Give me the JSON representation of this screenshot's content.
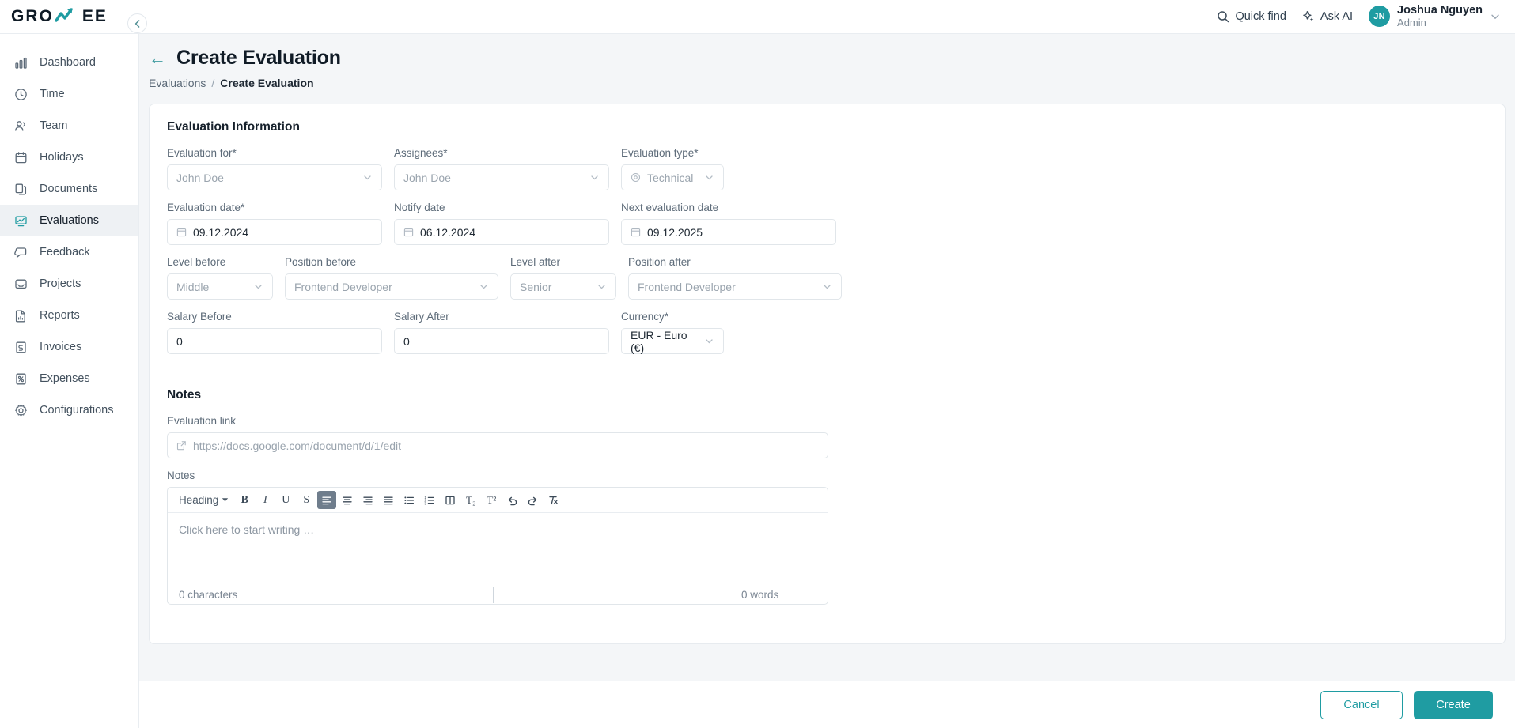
{
  "brand": {
    "name_left": "GRO",
    "name_right": "EE",
    "accent": "#1f9ca2"
  },
  "topbar": {
    "quick_find": "Quick find",
    "ask_ai": "Ask AI",
    "user": {
      "initials": "JN",
      "name": "Joshua Nguyen",
      "role": "Admin"
    }
  },
  "sidebar": {
    "items": [
      {
        "label": "Dashboard",
        "icon": "bar-chart-icon",
        "active": false
      },
      {
        "label": "Time",
        "icon": "clock-icon",
        "active": false
      },
      {
        "label": "Team",
        "icon": "users-icon",
        "active": false
      },
      {
        "label": "Holidays",
        "icon": "calendar-icon",
        "active": false
      },
      {
        "label": "Documents",
        "icon": "documents-icon",
        "active": false
      },
      {
        "label": "Evaluations",
        "icon": "evaluations-icon",
        "active": true
      },
      {
        "label": "Feedback",
        "icon": "chat-icon",
        "active": false
      },
      {
        "label": "Projects",
        "icon": "inbox-icon",
        "active": false
      },
      {
        "label": "Reports",
        "icon": "report-icon",
        "active": false
      },
      {
        "label": "Invoices",
        "icon": "invoice-icon",
        "active": false
      },
      {
        "label": "Expenses",
        "icon": "expenses-icon",
        "active": false
      },
      {
        "label": "Configurations",
        "icon": "gear-icon",
        "active": false
      }
    ]
  },
  "page": {
    "title": "Create Evaluation",
    "breadcrumb": {
      "parent": "Evaluations",
      "separator": "/",
      "current": "Create Evaluation"
    }
  },
  "evaluation_information": {
    "section_title": "Evaluation Information",
    "fields": {
      "evaluation_for": {
        "label": "Evaluation for*",
        "value": "John Doe"
      },
      "assignees": {
        "label": "Assignees*",
        "value": "John Doe"
      },
      "evaluation_type": {
        "label": "Evaluation type*",
        "value": "Technical"
      },
      "evaluation_date": {
        "label": "Evaluation date*",
        "value": "09.12.2024"
      },
      "notify_date": {
        "label": "Notify date",
        "value": "06.12.2024"
      },
      "next_evaluation_date": {
        "label": "Next evaluation date",
        "value": "09.12.2025"
      },
      "level_before": {
        "label": "Level before",
        "value": "Middle"
      },
      "position_before": {
        "label": "Position before",
        "value": "Frontend Developer"
      },
      "level_after": {
        "label": "Level after",
        "value": "Senior"
      },
      "position_after": {
        "label": "Position after",
        "value": "Frontend Developer"
      },
      "salary_before": {
        "label": "Salary Before",
        "value": "0"
      },
      "salary_after": {
        "label": "Salary After",
        "value": "0"
      },
      "currency": {
        "label": "Currency*",
        "value": "EUR - Euro (€)"
      }
    }
  },
  "notes": {
    "section_title": "Notes",
    "link": {
      "label": "Evaluation link",
      "placeholder": "https://docs.google.com/document/d/1/edit",
      "value": ""
    },
    "editor": {
      "label": "Notes",
      "heading_select": "Heading",
      "placeholder": "Click here to start writing …",
      "characters": "0 characters",
      "words": "0 words",
      "toolbar": [
        {
          "name": "bold-button",
          "glyph": "B",
          "active": false
        },
        {
          "name": "italic-button",
          "glyph": "I",
          "active": false
        },
        {
          "name": "underline-button",
          "glyph": "U",
          "active": false
        },
        {
          "name": "strikethrough-button",
          "glyph": "S",
          "active": false
        },
        {
          "name": "align-left-button",
          "glyph": "",
          "active": true
        },
        {
          "name": "align-center-button",
          "glyph": "",
          "active": false
        },
        {
          "name": "align-right-button",
          "glyph": "",
          "active": false
        },
        {
          "name": "align-justify-button",
          "glyph": "",
          "active": false
        },
        {
          "name": "bullet-list-button",
          "glyph": "",
          "active": false
        },
        {
          "name": "numbered-list-button",
          "glyph": "",
          "active": false
        },
        {
          "name": "columns-button",
          "glyph": "",
          "active": false
        },
        {
          "name": "subscript-button",
          "glyph": "T₂",
          "active": false
        },
        {
          "name": "superscript-button",
          "glyph": "T²",
          "active": false
        },
        {
          "name": "undo-button",
          "glyph": "↺",
          "active": false
        },
        {
          "name": "redo-button",
          "glyph": "↻",
          "active": false
        },
        {
          "name": "clear-format-button",
          "glyph": "",
          "active": false
        }
      ]
    }
  },
  "footer": {
    "cancel": "Cancel",
    "create": "Create"
  }
}
